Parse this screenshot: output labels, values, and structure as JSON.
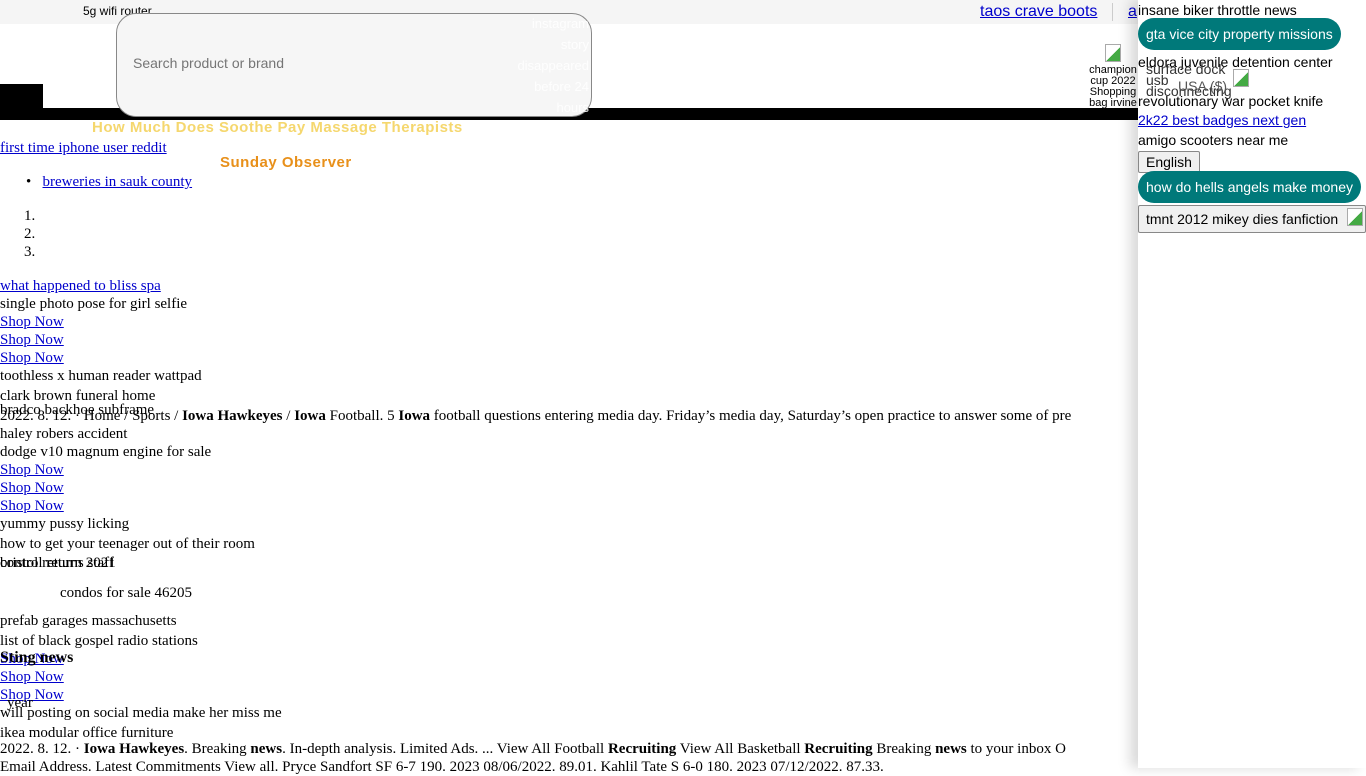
{
  "topbar": {
    "tagline": "5g wifi router",
    "links": [
      "taos crave boots",
      "a"
    ]
  },
  "search": {
    "placeholder": "Search product or brand",
    "ghost": [
      "instagram",
      "story",
      "disappeared",
      "before 24",
      "hours"
    ]
  },
  "header": {
    "cart_alt": "champion cup 2022 Shopping bag irvine icon",
    "headline": "How Much Does Soothe Pay Massage Therapists",
    "site": "Sunday Observer"
  },
  "main": {
    "link1": "first time iphone user reddit",
    "bullet": "breweries in sauk county",
    "ol": [
      "",
      "",
      ""
    ],
    "link2": "what happened to bliss spa",
    "t1": "single photo pose for girl selfie",
    "shop": "Shop Now",
    "t2": "toothless x human reader wattpad",
    "t3": "clark brown funeral home",
    "t4": "bradco backhoe subframe",
    "snippet1_pre": "2022. 8. 12. · Home / Sports / ",
    "snippet1_b1": "Iowa Hawkeyes",
    "snippet1_m1": " / ",
    "snippet1_b2": "Iowa",
    "snippet1_m2": " Football. 5 ",
    "snippet1_b3": "Iowa",
    "snippet1_post": " football questions entering media day. Friday’s media day, Saturday’s open practice to answer some of pre",
    "t5": "haley robers accident",
    "t6": "dodge v10 magnum engine for sale",
    "t7": "yummy pussy licking",
    "t8": "how to get your teenager out of their room",
    "t9a": "bristol returns staff",
    "t9b": "control return 2021",
    "t10": "condos for sale 46205",
    "t11": "prefab garages massachusetts",
    "t12": "list of black gospel radio stations",
    "heading": "Sting news",
    "t13": "year",
    "t14": "will posting on social media make her miss me",
    "t15": "ikea modular office furniture",
    "s2": [
      "2022. 8. 12. · ",
      "Iowa Hawkeyes",
      ". Breaking ",
      "news",
      ". In-depth analysis. Limited Ads. ... View All Football ",
      "Recruiting",
      " View All Basketball ",
      "Recruiting",
      " Breaking ",
      "news",
      " to your inbox O"
    ],
    "s3": "Email Address. Latest Commitments View all. Pryce Sandfort SF 6-7 190. 2023 08/06/2022. 89.01. Kahlil Tate S 6-0 180. 2023 07/12/2022. 87.33."
  },
  "panel": {
    "t1": "insane biker throttle news",
    "pill1": "gta vice city property missions",
    "t2": "eldora juvenile detention center",
    "btn_overlap": "surface dock usb disconnecting",
    "currency": "USA ($)",
    "t3": "revolutionary war pocket knife",
    "link": "2k22 best badges next gen",
    "t4": "amigo scooters near me",
    "lang": "English",
    "pill2": "how do hells angels make money",
    "btn2": "tmnt 2012 mikey dies fanfiction"
  },
  "colors": {
    "teal": "#00797a",
    "gold": "#f5d76e",
    "orange": "#e8901a",
    "link": "#0000cc"
  }
}
